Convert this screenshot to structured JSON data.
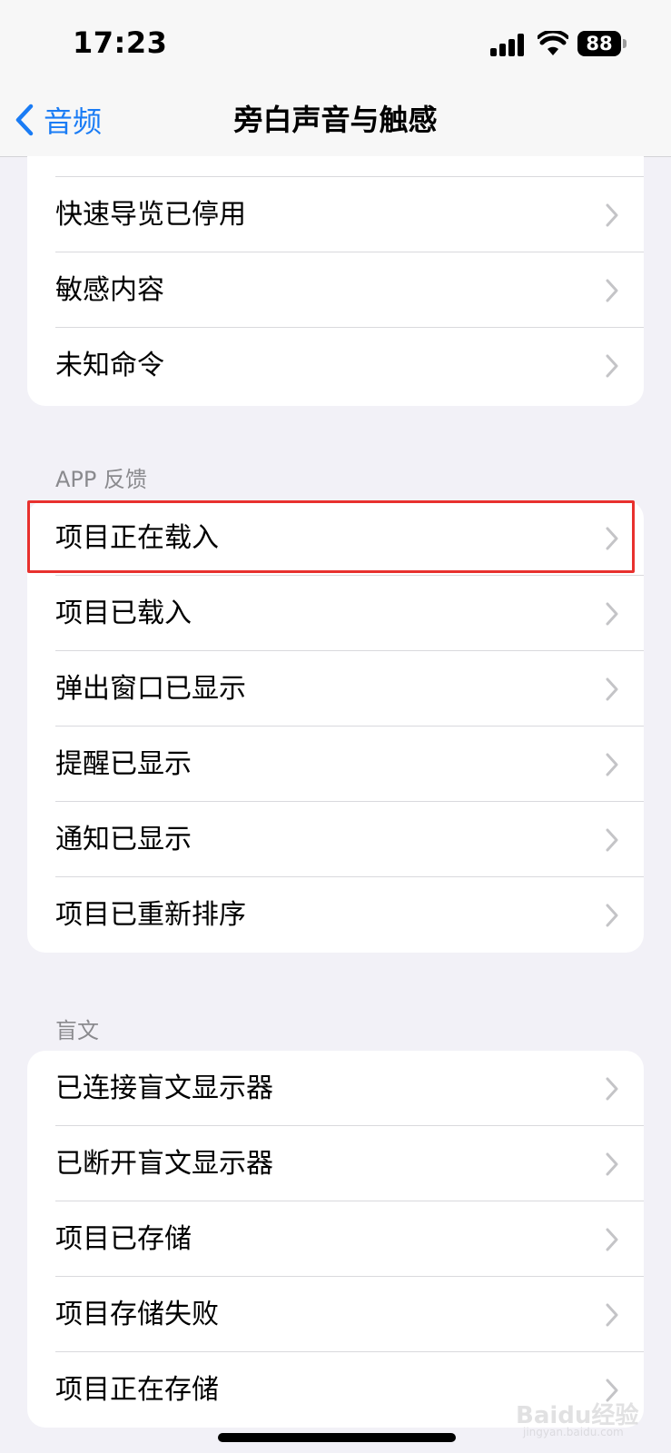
{
  "status_bar": {
    "time": "17:23",
    "battery": "88"
  },
  "nav": {
    "back_label": "音频",
    "title": "旁白声音与触感"
  },
  "groups": [
    {
      "header": "",
      "items": [
        {
          "label": "快速导览已停用"
        },
        {
          "label": "敏感内容"
        },
        {
          "label": "未知命令"
        }
      ]
    },
    {
      "header": "APP 反馈",
      "items": [
        {
          "label": "项目正在载入"
        },
        {
          "label": "项目已载入"
        },
        {
          "label": "弹出窗口已显示"
        },
        {
          "label": "提醒已显示"
        },
        {
          "label": "通知已显示"
        },
        {
          "label": "项目已重新排序"
        }
      ]
    },
    {
      "header": "盲文",
      "items": [
        {
          "label": "已连接盲文显示器"
        },
        {
          "label": "已断开盲文显示器"
        },
        {
          "label": "项目已存储"
        },
        {
          "label": "项目存储失败"
        },
        {
          "label": "项目正在存储"
        }
      ]
    }
  ],
  "watermark": {
    "text": "Baidu经验",
    "sub": "jingyan.baidu.com"
  },
  "colors": {
    "accent": "#1a7cf5",
    "highlight": "#e8312e",
    "background": "#f2f1f7"
  }
}
